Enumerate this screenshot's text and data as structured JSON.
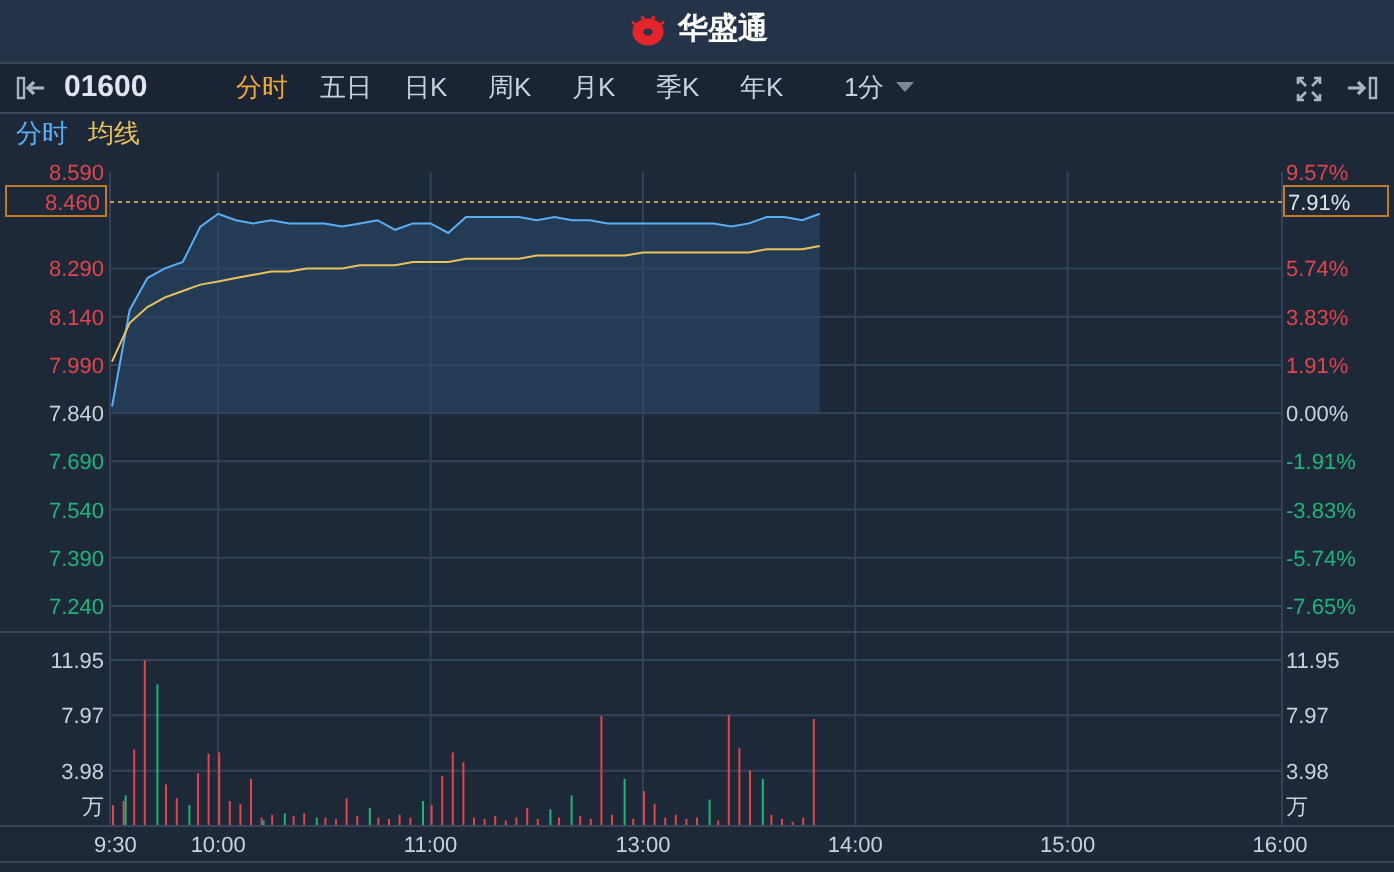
{
  "header": {
    "title": "华盛通"
  },
  "toolbar": {
    "code": "01600",
    "periods": [
      {
        "label": "分时",
        "selected": true
      },
      {
        "label": "五日",
        "selected": false
      },
      {
        "label": "日K",
        "selected": false
      },
      {
        "label": "周K",
        "selected": false
      },
      {
        "label": "月K",
        "selected": false
      },
      {
        "label": "季K",
        "selected": false
      },
      {
        "label": "年K",
        "selected": false
      }
    ],
    "interval": "1分"
  },
  "price_chart": {
    "current_price": "8.460",
    "current_percent": "7.91%",
    "percent_ticks": [
      {
        "label": "9.57%",
        "color": "#e0454c"
      },
      {
        "label": "5.74%",
        "color": "#e0454c"
      },
      {
        "label": "3.83%",
        "color": "#e0454c"
      },
      {
        "label": "1.91%",
        "color": "#e0454c"
      },
      {
        "label": "0.00%",
        "color": "#c9d1dc"
      },
      {
        "label": "-1.91%",
        "color": "#1fb57a"
      },
      {
        "label": "-3.83%",
        "color": "#1fb57a"
      },
      {
        "label": "-5.74%",
        "color": "#1fb57a"
      },
      {
        "label": "-7.65%",
        "color": "#1fb57a"
      }
    ],
    "chart_data": {
      "type": "line",
      "grid": true,
      "ylim": [
        7.24,
        8.59
      ],
      "yticks": [
        {
          "value": 8.59,
          "label": "8.590"
        },
        {
          "value": 8.29,
          "label": "8.290"
        },
        {
          "value": 8.14,
          "label": "8.140"
        },
        {
          "value": 7.99,
          "label": "7.990"
        },
        {
          "value": 7.84,
          "label": "7.840"
        },
        {
          "value": 7.69,
          "label": "7.690"
        },
        {
          "value": 7.54,
          "label": "7.540"
        },
        {
          "value": 7.39,
          "label": "7.390"
        },
        {
          "value": 7.24,
          "label": "7.240"
        }
      ],
      "categories": [
        null,
        null,
        null,
        null,
        null,
        null,
        null,
        null,
        null,
        null,
        null,
        null,
        null,
        null,
        null,
        null,
        null,
        null,
        null,
        null,
        null,
        null,
        null,
        null,
        null,
        null,
        null,
        null,
        null,
        null,
        null,
        null,
        null,
        null,
        null,
        null,
        null,
        null,
        null,
        null,
        null,
        null,
        null,
        null,
        null,
        null,
        null,
        null,
        null,
        null,
        null,
        null,
        null,
        null,
        null,
        null,
        null,
        null,
        null,
        null,
        null,
        null,
        null,
        null,
        null,
        null,
        null
      ],
      "series": [
        {
          "name": "分时",
          "color": "#5aaef5",
          "values": [
            7.86,
            8.16,
            8.26,
            8.29,
            8.31,
            8.42,
            8.46,
            8.44,
            8.43,
            8.44,
            8.43,
            8.43,
            8.43,
            8.42,
            8.43,
            8.44,
            8.41,
            8.43,
            8.43,
            8.4,
            8.45,
            8.45,
            8.45,
            8.45,
            8.44,
            8.45,
            8.44,
            8.44,
            8.43,
            8.43,
            8.43,
            8.43,
            8.43,
            8.43,
            8.43,
            8.42,
            8.43,
            8.45,
            8.45,
            8.44,
            8.46,
            null,
            null,
            null,
            null,
            null,
            null,
            null,
            null,
            null,
            null,
            null,
            null,
            null,
            null,
            null,
            null,
            null,
            null,
            null,
            null,
            null,
            null,
            null,
            null,
            null,
            null
          ]
        },
        {
          "name": "均线",
          "color": "#e9c25c",
          "values": [
            8.0,
            8.12,
            8.17,
            8.2,
            8.22,
            8.24,
            8.25,
            8.26,
            8.27,
            8.28,
            8.28,
            8.29,
            8.29,
            8.29,
            8.3,
            8.3,
            8.3,
            8.31,
            8.31,
            8.31,
            8.32,
            8.32,
            8.32,
            8.32,
            8.33,
            8.33,
            8.33,
            8.33,
            8.33,
            8.33,
            8.34,
            8.34,
            8.34,
            8.34,
            8.34,
            8.34,
            8.34,
            8.35,
            8.35,
            8.35,
            8.36,
            null,
            null,
            null,
            null,
            null,
            null,
            null,
            null,
            null,
            null,
            null,
            null,
            null,
            null,
            null,
            null,
            null,
            null,
            null,
            null,
            null,
            null,
            null,
            null,
            null,
            null
          ]
        }
      ]
    }
  },
  "volume_chart": {
    "unit": "万",
    "right_ticks": [
      "11.95",
      "7.97",
      "3.98"
    ],
    "right_unit": "万",
    "chart_data": {
      "type": "bar",
      "stacked": false,
      "grid": true,
      "ylim": [
        0,
        11.95
      ],
      "yticks": [
        {
          "value": 11.95,
          "label": "11.95"
        },
        {
          "value": 7.97,
          "label": "7.97"
        },
        {
          "value": 3.98,
          "label": "3.98"
        }
      ],
      "categories": [
        "9:30",
        null,
        null,
        null,
        null,
        null,
        null,
        null,
        null,
        null,
        "10:00",
        null,
        null,
        null,
        null,
        null,
        null,
        null,
        null,
        null,
        null,
        null,
        null,
        null,
        null,
        null,
        null,
        null,
        null,
        null,
        "11:00",
        null,
        null,
        null,
        null,
        null,
        null,
        null,
        null,
        null,
        null,
        null,
        null,
        null,
        null,
        null,
        null,
        null,
        null,
        null,
        "13:00",
        null,
        null,
        null,
        null,
        null,
        null,
        null,
        null,
        null,
        null,
        null,
        null,
        null,
        null,
        null,
        null,
        null,
        null,
        null,
        "14:00",
        null,
        null,
        null,
        null,
        null,
        null,
        null,
        null,
        null,
        null,
        null,
        null,
        null,
        null,
        null,
        null,
        null,
        null,
        null,
        "15:00",
        null,
        null,
        null,
        null,
        null,
        null,
        null,
        null,
        null,
        null,
        null,
        null,
        null,
        null,
        null,
        null,
        null,
        null,
        null,
        "16:00"
      ],
      "series": [
        {
          "color": "#e0454c",
          "values": [
            1.5,
            1.8,
            5.5,
            11.9,
            null,
            3.0,
            2.0,
            null,
            3.8,
            5.2,
            5.3,
            1.8,
            1.6,
            3.4,
            0.6,
            0.8,
            null,
            0.7,
            0.9,
            null,
            0.6,
            0.5,
            2.0,
            0.7,
            null,
            0.6,
            0.5,
            0.8,
            0.6,
            null,
            1.5,
            3.6,
            5.3,
            4.6,
            0.6,
            0.5,
            0.7,
            0.4,
            0.6,
            1.3,
            0.5,
            null,
            0.6,
            null,
            0.7,
            0.5,
            7.9,
            0.8,
            null,
            0.5,
            2.5,
            1.6,
            0.6,
            0.8,
            0.5,
            0.6,
            null,
            0.4,
            8.0,
            5.6,
            4.0,
            null,
            0.8,
            0.5,
            0.3,
            0.6,
            7.7,
            null,
            null,
            null,
            null,
            null,
            null,
            null,
            null,
            null,
            null,
            null,
            null,
            null,
            null,
            null,
            null,
            null,
            null,
            null,
            null,
            null,
            null,
            null,
            null,
            null,
            null,
            null,
            null,
            null,
            null,
            null,
            null,
            null,
            null,
            null,
            null,
            null,
            null,
            null,
            null,
            null,
            null,
            null,
            null
          ]
        },
        {
          "color": "#1fb57a",
          "values": [
            null,
            2.2,
            null,
            null,
            10.2,
            null,
            null,
            1.5,
            null,
            null,
            null,
            null,
            null,
            null,
            0.4,
            null,
            0.9,
            null,
            null,
            0.6,
            null,
            null,
            null,
            null,
            1.3,
            null,
            null,
            null,
            null,
            1.8,
            null,
            null,
            null,
            null,
            null,
            null,
            null,
            null,
            null,
            null,
            null,
            1.2,
            null,
            2.2,
            null,
            null,
            null,
            null,
            3.4,
            null,
            null,
            null,
            null,
            null,
            null,
            null,
            1.9,
            null,
            null,
            null,
            null,
            3.4,
            null,
            null,
            null,
            null,
            null,
            null,
            null,
            null,
            null,
            null,
            null,
            null,
            null,
            null,
            null,
            null,
            null,
            null,
            null,
            null,
            null,
            null,
            null,
            null,
            null,
            null,
            null,
            null,
            null,
            null,
            null,
            null,
            null,
            null,
            null,
            null,
            null,
            null,
            null,
            null,
            null,
            null,
            null,
            null,
            null,
            null,
            null,
            null,
            null
          ]
        }
      ]
    }
  }
}
